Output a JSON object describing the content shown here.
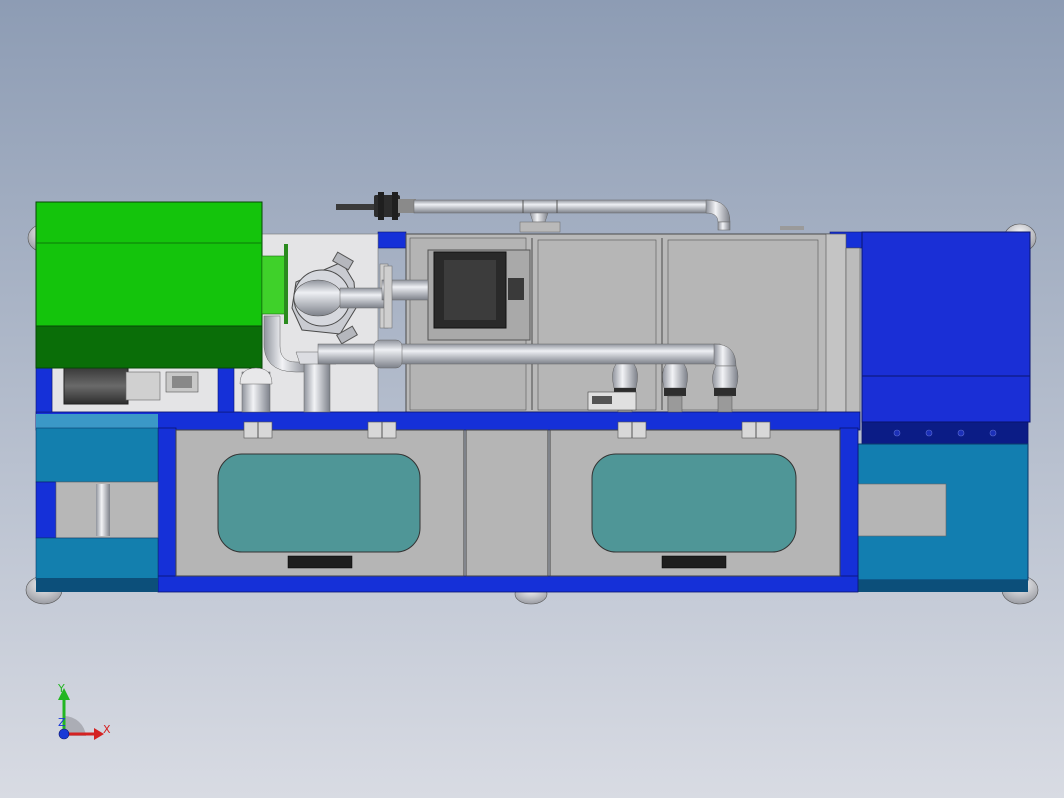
{
  "colors": {
    "bg_top": "#93a2b8",
    "bg_bottom": "#d6d9e2",
    "frame_blue": "#1530d8",
    "frame_blue_dark": "#0c1c9a",
    "teal_panel": "#137fae",
    "teal_panel_light": "#3b98c7",
    "navy_panel": "#0a1d8a",
    "green_box": "#14c40c",
    "green_box_dark": "#0a6e08",
    "bright_green": "#3fd12a",
    "steel": "#b9b9b9",
    "steel_dark": "#8e8e8e",
    "glass": "#4f9697",
    "pipe": "#c9cdd6"
  },
  "triad": {
    "y_label": "Y",
    "x_label": "X",
    "z_label": "Z"
  }
}
